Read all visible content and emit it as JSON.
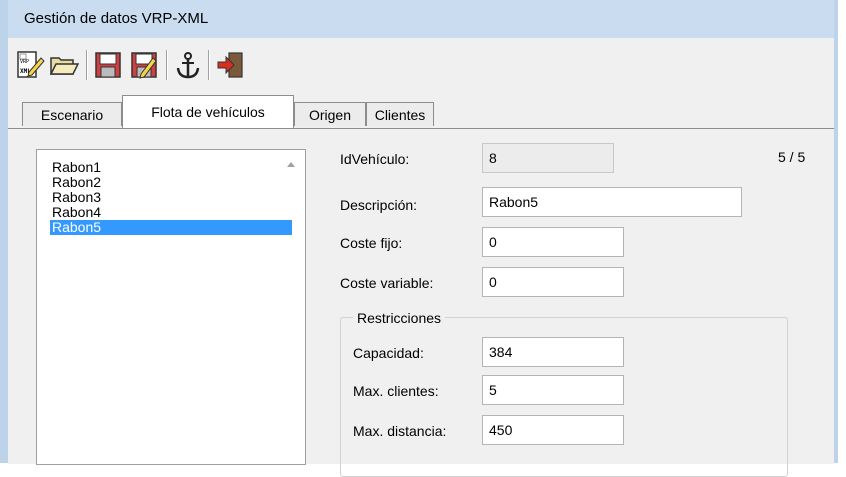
{
  "window": {
    "title": "Gestión de datos VRP-XML"
  },
  "toolbar": {
    "buttons": [
      {
        "icon": "xml-edit-icon"
      },
      {
        "icon": "folder-open-icon"
      },
      {
        "icon": "save-icon"
      },
      {
        "icon": "save-edit-icon"
      },
      {
        "icon": "anchor-icon"
      },
      {
        "icon": "exit-icon"
      }
    ]
  },
  "tabs": [
    {
      "label": "Escenario"
    },
    {
      "label": "Flota de vehículos"
    },
    {
      "label": "Origen"
    },
    {
      "label": "Clientes"
    }
  ],
  "active_tab": "Flota de vehículos",
  "vehicle_list": {
    "items": [
      "Rabon1",
      "Rabon2",
      "Rabon3",
      "Rabon4",
      "Rabon5"
    ],
    "selected": "Rabon5"
  },
  "record_counter": "5 / 5",
  "form": {
    "id_label": "IdVehículo:",
    "id_value": "8",
    "desc_label": "Descripción:",
    "desc_value": "Rabon5",
    "fixed_cost_label": "Coste fijo:",
    "fixed_cost_value": "0",
    "var_cost_label": "Coste variable:",
    "var_cost_value": "0"
  },
  "restrictions": {
    "legend": "Restricciones",
    "capacity_label": "Capacidad:",
    "capacity_value": "384",
    "max_clients_label": "Max. clientes:",
    "max_clients_value": "5",
    "max_distance_label": "Max. distancia:",
    "max_distance_value": "450"
  },
  "colors": {
    "titlebar": "#c9dcf0",
    "selection": "#3399ff",
    "panel": "#f0f0f0"
  }
}
